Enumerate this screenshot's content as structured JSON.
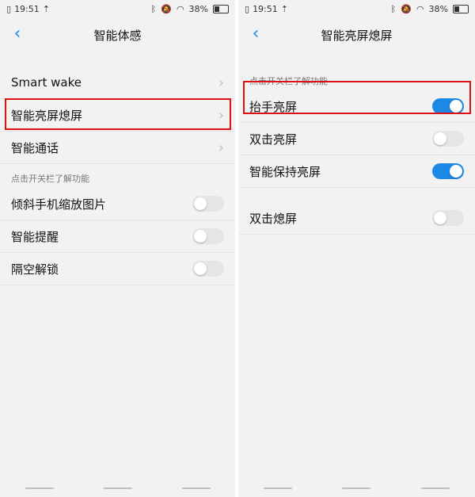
{
  "left": {
    "status": {
      "time": "19:51",
      "battery": "38%"
    },
    "title": "智能体感",
    "items": [
      {
        "label": "Smart wake"
      },
      {
        "label": "智能亮屏熄屏"
      },
      {
        "label": "智能通话"
      }
    ],
    "section_label": "点击开关栏了解功能",
    "toggles": [
      {
        "label": "倾斜手机缩放图片",
        "on": false
      },
      {
        "label": "智能提醒",
        "on": false
      },
      {
        "label": "隔空解锁",
        "on": false
      }
    ]
  },
  "right": {
    "status": {
      "time": "19:51",
      "battery": "38%"
    },
    "title": "智能亮屏熄屏",
    "section_label": "点击开关栏了解功能",
    "toggles_top": [
      {
        "label": "抬手亮屏",
        "on": true
      },
      {
        "label": "双击亮屏",
        "on": false
      },
      {
        "label": "智能保持亮屏",
        "on": true
      }
    ],
    "toggles_bottom": [
      {
        "label": "双击熄屏",
        "on": false
      }
    ]
  },
  "colors": {
    "accent": "#1e88e5",
    "highlight": "#d11111"
  },
  "icons": {
    "back": "chevron-left-icon",
    "chevron": "chevron-right-icon"
  }
}
